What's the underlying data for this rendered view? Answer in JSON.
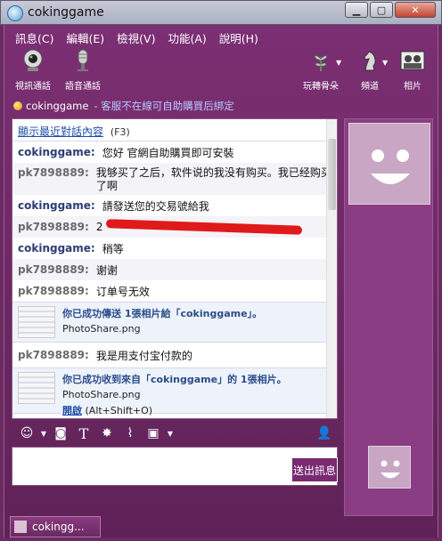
{
  "window": {
    "title": "cokinggame"
  },
  "menu": [
    "訊息(C)",
    "編輯(E)",
    "檢視(V)",
    "功能(A)",
    "說明(H)"
  ],
  "toolbar": {
    "video_call": "視訊通話",
    "voice_call": "語音通話",
    "games_label": "玩轉骨朵",
    "channel_label": "頻道",
    "photos_label": "相片"
  },
  "status": {
    "name": "cokinggame",
    "message": "- 客服不在線可自助購買后綁定"
  },
  "chat": {
    "show_recent": "顯示最近對話內容",
    "hotkey": "(F3)",
    "messages": [
      {
        "who": "cokinggame:",
        "text": "您好  官網自助購買即可安裝"
      },
      {
        "who": "pk7898889:",
        "text": "我够买了之后，软件说的我没有购买。我已经购买了啊"
      },
      {
        "who": "cokinggame:",
        "text": "請發送您的交易號給我"
      },
      {
        "who": "pk7898889:",
        "text": "2"
      },
      {
        "who": "cokinggame:",
        "text": "稍等"
      },
      {
        "who": "pk7898889:",
        "text": "谢谢"
      },
      {
        "who": "pk7898889:",
        "text": "订单号无效"
      },
      {
        "who": "pk7898889:",
        "text": "我是用支付宝付款的"
      }
    ],
    "sent_photo": {
      "text": "你已成功傳送 1張相片給「cokinggame」。",
      "file": "PhotoShare.png"
    },
    "recv_photo": {
      "text": "你已成功收到來自「cokinggame」的 1張相片。",
      "file": "PhotoShare.png",
      "open": "開啟",
      "shortcut": "(Alt+Shift+O)"
    }
  },
  "send_label": "送出訊息",
  "taskbar": {
    "tab": "cokingg..."
  }
}
